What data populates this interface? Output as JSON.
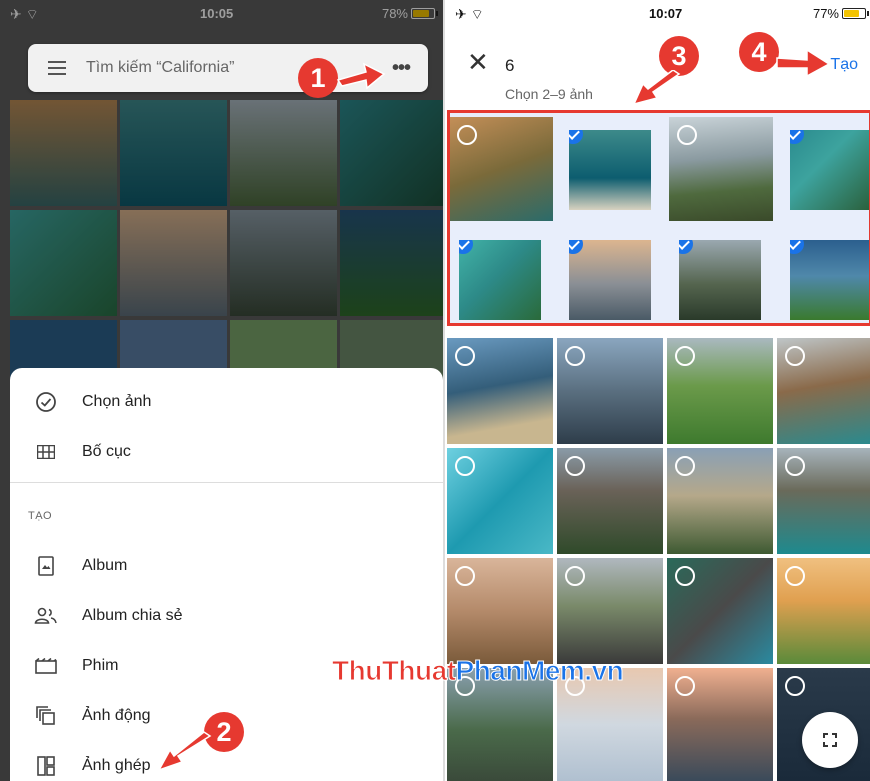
{
  "left": {
    "status": {
      "time": "10:05",
      "battery": "78%",
      "battery_level": 0.78
    },
    "search": {
      "text": "Tìm kiếm “California”"
    },
    "menu": {
      "items": [
        {
          "label": "Chọn ảnh",
          "icon": "check-circle-icon"
        },
        {
          "label": "Bố cục",
          "icon": "grid-layout-icon"
        }
      ],
      "section_label": "TẠO",
      "create_items": [
        {
          "label": "Album",
          "icon": "album-icon"
        },
        {
          "label": "Album chia sẻ",
          "icon": "shared-album-icon"
        },
        {
          "label": "Phim",
          "icon": "movie-icon"
        },
        {
          "label": "Ảnh động",
          "icon": "animation-icon"
        },
        {
          "label": "Ảnh ghép",
          "icon": "collage-icon"
        }
      ]
    },
    "steps": [
      "1",
      "2"
    ]
  },
  "right": {
    "status": {
      "time": "10:07",
      "battery": "77%",
      "battery_level": 0.77
    },
    "header": {
      "count": "6",
      "subtitle": "Chọn 2–9 ảnh",
      "create_label": "Tạo"
    },
    "steps": [
      "3",
      "4"
    ],
    "selected_flags": [
      false,
      true,
      false,
      true,
      true,
      true,
      true,
      true
    ]
  },
  "watermark": {
    "part1": "Thu",
    "part2": "Thuat",
    "part3": "Phan",
    "part4": "Mem",
    "part5": ".vn"
  },
  "colors": {
    "accent": "#1a73e8",
    "annotation": "#e63930"
  }
}
